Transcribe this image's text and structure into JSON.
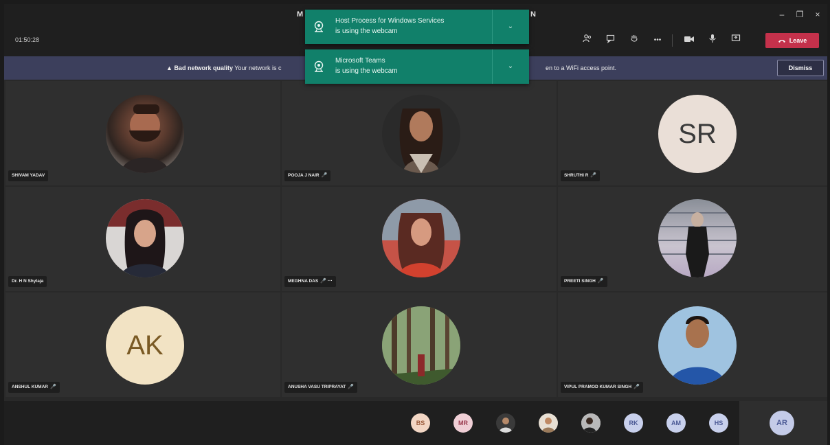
{
  "window": {
    "title_left": "M",
    "title_right": "N",
    "minimize": "–",
    "maximize": "❐",
    "close": "×"
  },
  "toolbar": {
    "timer": "01:50:28",
    "leave_label": "Leave",
    "more": "•••"
  },
  "banner": {
    "warning_icon": "▲",
    "title": "Bad network quality",
    "message_start": "Your network is c",
    "message_end": "en to a WiFi access point.",
    "dismiss_label": "Dismiss"
  },
  "toasts": [
    {
      "line1": "Host Process for Windows Services",
      "line2": "is using the webcam",
      "chevron": "⌄"
    },
    {
      "line1": "Microsoft Teams",
      "line2": "is using the webcam",
      "chevron": "⌄"
    }
  ],
  "participants": [
    {
      "name": "SHIVAM YADAV",
      "mic": ""
    },
    {
      "name": "POOJA J NAIR",
      "mic": "🎤"
    },
    {
      "name": "SHRUTHI R",
      "mic": "🎤",
      "initials": "SR"
    },
    {
      "name": "Dr. H N Shylaja",
      "mic": ""
    },
    {
      "name": "MEGHNA DAS",
      "mic": "🎤 ···"
    },
    {
      "name": "PREETI SINGH",
      "mic": "🎤"
    },
    {
      "name": "ANSHUL KUMAR",
      "mic": "🎤",
      "initials": "AK"
    },
    {
      "name": "ANUSHA VASU TRIPRAYAT",
      "mic": "🎤"
    },
    {
      "name": "VIPUL PRAMOD KUMAR SINGH",
      "mic": "🎤"
    }
  ],
  "overflow": [
    {
      "initials": "BS"
    },
    {
      "initials": "MR"
    },
    {
      "initials": ""
    },
    {
      "initials": ""
    },
    {
      "initials": ""
    },
    {
      "initials": "RK"
    },
    {
      "initials": "AM"
    },
    {
      "initials": "HS"
    }
  ],
  "self": {
    "initials": "AR"
  },
  "colors": {
    "leave": "#c4314b",
    "banner": "#3c3f5c",
    "toast": "#11806a"
  }
}
